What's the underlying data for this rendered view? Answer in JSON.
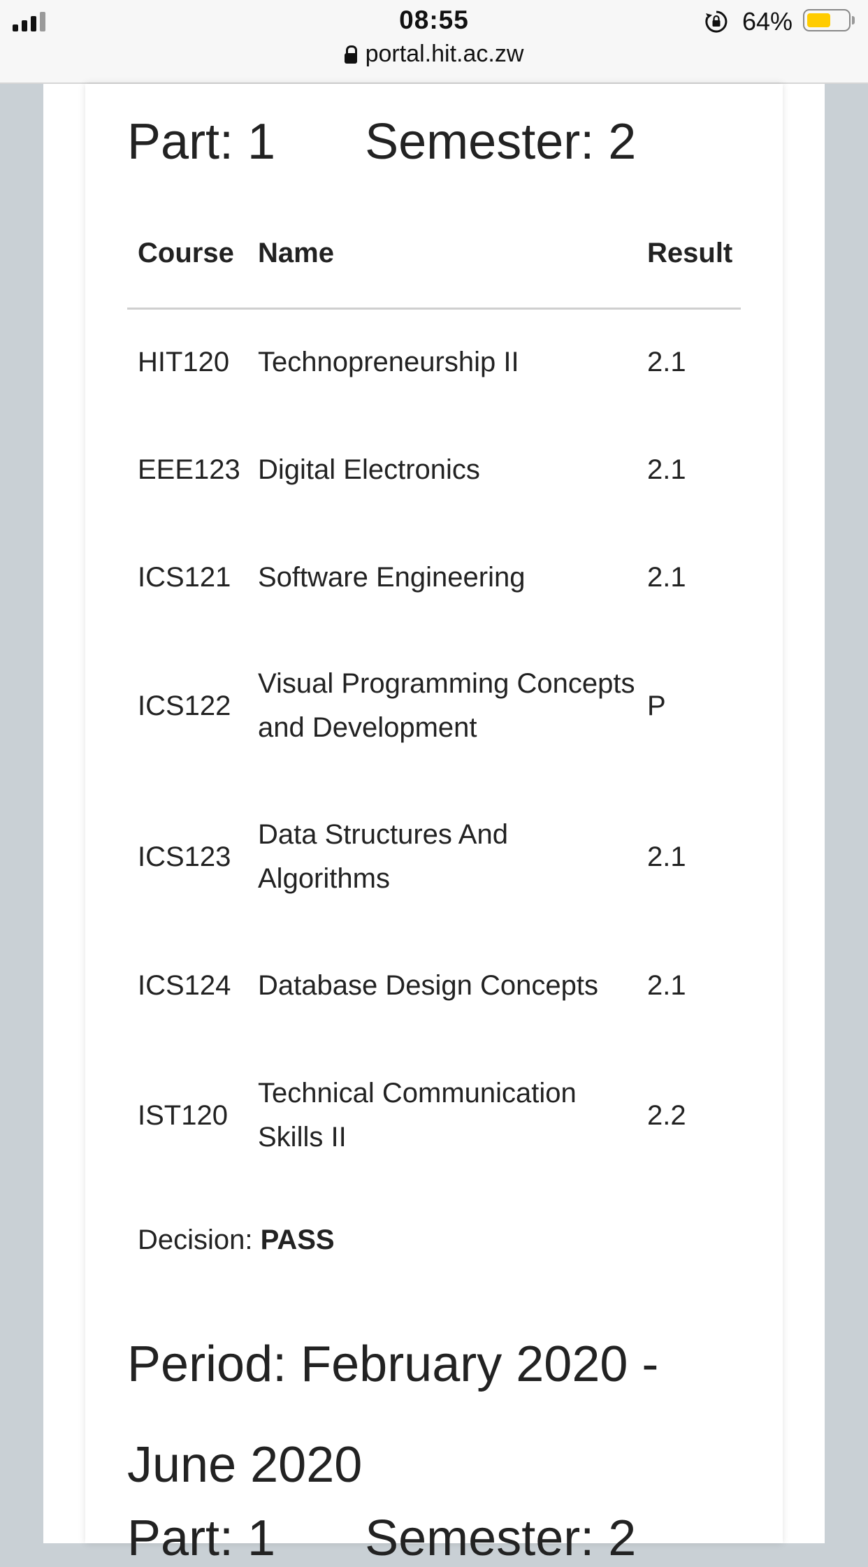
{
  "status_bar": {
    "time": "08:55",
    "url": "portal.hit.ac.zw",
    "battery_percent": "64%",
    "battery_level": 0.64,
    "icons": [
      "signal-icon",
      "lock-icon",
      "rotation-lock-icon",
      "battery-icon"
    ]
  },
  "section": {
    "part_label": "Part: 1",
    "semester_label": "Semester: 2",
    "columns": {
      "course": "Course",
      "name": "Name",
      "result": "Result"
    },
    "rows": [
      {
        "code": "HIT120",
        "name": "Technopreneurship II",
        "result": "2.1"
      },
      {
        "code": "EEE123",
        "name": "Digital Electronics",
        "result": "2.1"
      },
      {
        "code": "ICS121",
        "name": "Software Engineering",
        "result": "2.1"
      },
      {
        "code": "ICS122",
        "name": "Visual Programming Concepts and Development",
        "result": "P"
      },
      {
        "code": "ICS123",
        "name": "Data Structures And Algorithms",
        "result": "2.1"
      },
      {
        "code": "ICS124",
        "name": "Database Design Concepts",
        "result": "2.1"
      },
      {
        "code": "IST120",
        "name": "Technical Communication Skills II",
        "result": "2.2"
      }
    ],
    "decision_label": "Decision:",
    "decision_value": "PASS"
  },
  "next_section": {
    "period_label": "Period: February 2020 - June 2020",
    "part_label": "Part: 1",
    "semester_label": "Semester: 2"
  }
}
